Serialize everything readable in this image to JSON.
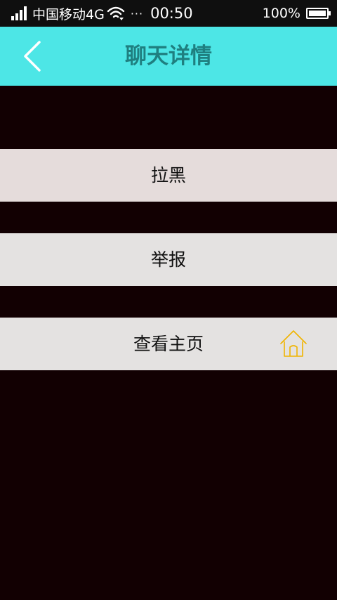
{
  "status_bar": {
    "carrier": "中国移动4G",
    "dots": "···",
    "time": "00:50",
    "battery": "100%"
  },
  "header": {
    "title": "聊天详情",
    "back_icon": "chevron-left-icon",
    "background_color": "#4de6e6",
    "title_color": "#1f7f80"
  },
  "menu": {
    "items": [
      {
        "label": "拉黑"
      },
      {
        "label": "举报"
      },
      {
        "label": "查看主页",
        "icon": "home-icon",
        "icon_color": "#f0b400"
      }
    ]
  },
  "colors": {
    "page_background": "#120002"
  }
}
